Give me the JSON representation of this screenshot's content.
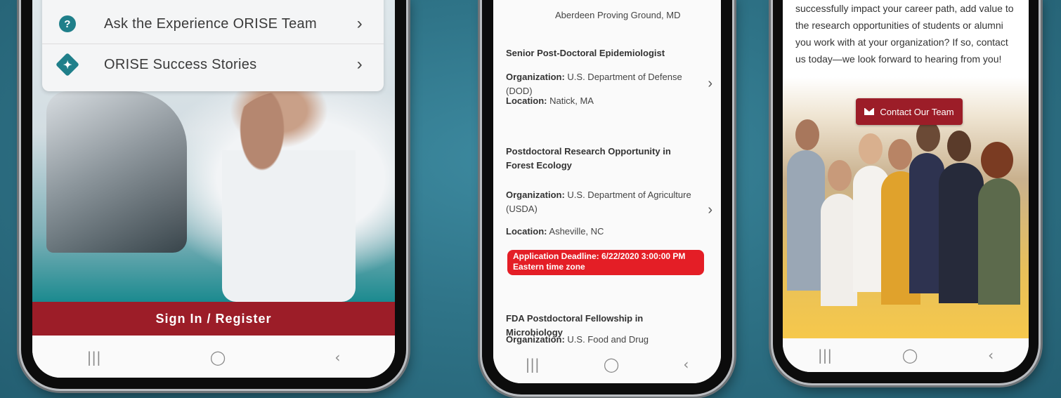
{
  "phone1": {
    "menu": [
      {
        "label": "Ask the Experience ORISE Team",
        "icon": "question-circle-icon"
      },
      {
        "label": "ORISE Success Stories",
        "icon": "star-badge-icon"
      }
    ],
    "signin_label": "Sign In / Register"
  },
  "phone2": {
    "top_location": "Aberdeen Proving Ground, MD",
    "jobs": [
      {
        "title": "Senior Post-Doctoral Epidemiologist",
        "organization_label": "Organization:",
        "organization": "U.S. Department of Defense (DOD)",
        "location_label": "Location:",
        "location": "Natick, MA"
      },
      {
        "title": "Postdoctoral Research Opportunity in Forest Ecology",
        "organization_label": "Organization:",
        "organization": "U.S. Department of Agriculture (USDA)",
        "location_label": "Location:",
        "location": "Asheville, NC",
        "deadline": "Application Deadline: 6/22/2020 3:00:00 PM Eastern time zone"
      },
      {
        "title": "FDA Postdoctoral Fellowship in Microbiology",
        "organization_label": "Organization:",
        "organization": "U.S. Food and Drug Administration"
      }
    ]
  },
  "phone3": {
    "body_text": "successfully impact your career path, add value to the research opportunities of students or alumni you work with at your organization? If so, contact us today—we look forward to hearing from you!",
    "contact_button": "Contact Our Team"
  },
  "navbar": {
    "recents": "|||",
    "home": "◯",
    "back": "‹"
  },
  "colors": {
    "brand_red": "#9c1d28",
    "teal": "#1f7f8a",
    "deadline_red": "#e41e26"
  }
}
